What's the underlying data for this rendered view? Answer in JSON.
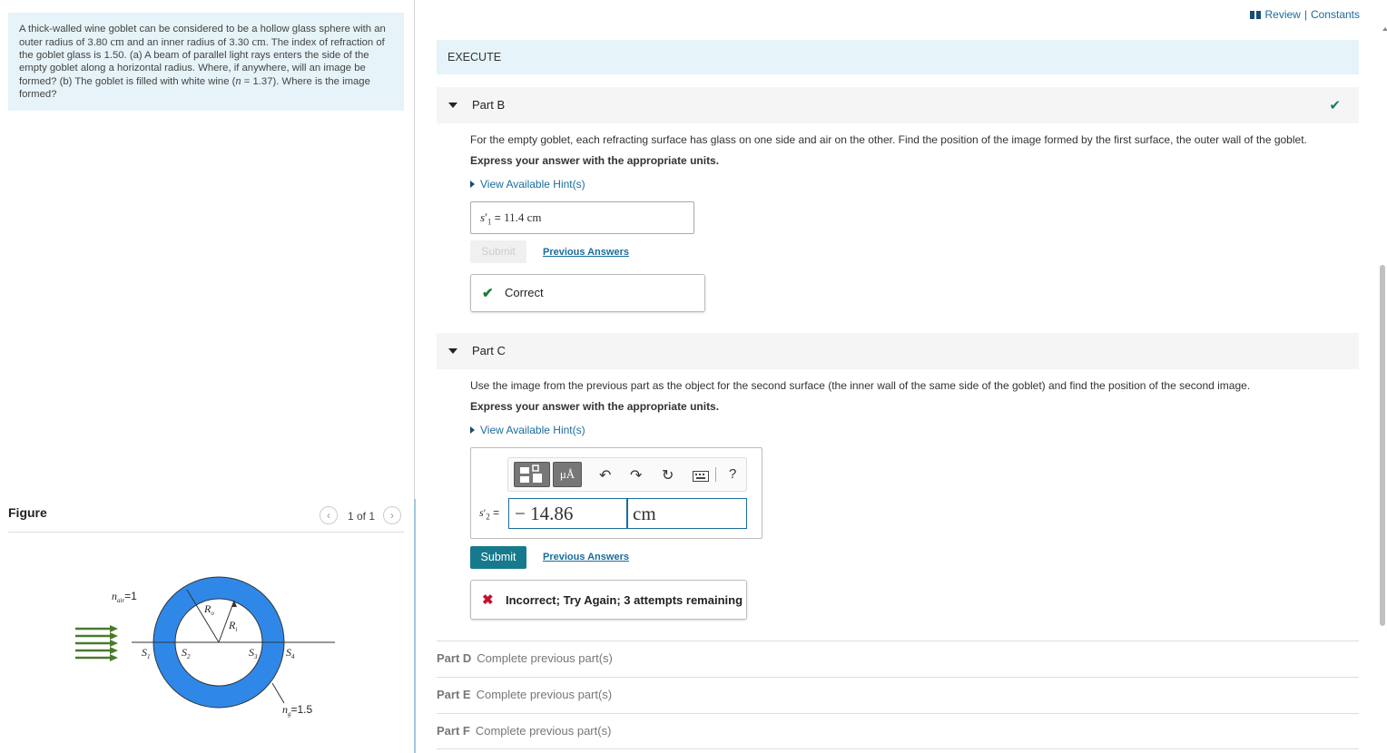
{
  "problem": {
    "parts": [
      "A thick-walled wine goblet can be considered to be a hollow glass sphere with an outer radius of 3.80 ",
      "cm",
      " and an inner radius of 3.30 ",
      "cm",
      ". The index of refraction of the goblet glass is 1.50. (a) A beam of parallel light rays enters the side of the empty goblet along a horizontal radius. Where, if anywhere, will an image be formed? (b) The goblet is filled with white wine (",
      "n",
      " = 1.37). Where is the image formed?"
    ]
  },
  "figure": {
    "label": "Figure",
    "counter": "1 of 1",
    "n_air": "n",
    "n_air_sub": "air",
    "n_air_val": "=1",
    "n_g": "n",
    "n_g_sub": "g",
    "n_g_val": "=1.5",
    "Ro": "R",
    "Ro_sub": "o",
    "Ri": "R",
    "Ri_sub": "i",
    "S1": "S",
    "S1_sub": "1",
    "S2": "S",
    "S2_sub": "2",
    "S3": "S",
    "S3_sub": "3",
    "S4": "S",
    "S4_sub": "4",
    "colors": {
      "ring": "#2f88e8",
      "arrows": "#4a7a2a"
    }
  },
  "header": {
    "review": "Review",
    "sep": " | ",
    "constants": "Constants",
    "execute": "EXECUTE"
  },
  "partB": {
    "title": "Part B",
    "instruction": "For the empty goblet, each refracting surface has glass on one side and air on the other. Find the position of the image formed by the first surface, the outer wall of the goblet.",
    "units_note": "Express your answer with the appropriate units.",
    "hint": "View Available Hint(s)",
    "answer_label": "s",
    "answer_prime": "′",
    "answer_sub": "1",
    "answer_eq": " = ",
    "answer_value": "11.4 cm",
    "submit": "Submit",
    "previous": "Previous Answers",
    "feedback": "Correct"
  },
  "partC": {
    "title": "Part C",
    "instruction": "Use the image from the previous part as the object for the second surface (the inner wall of the same side of the goblet) and find the position of the second image.",
    "units_note": "Express your answer with the appropriate units.",
    "hint": "View Available Hint(s)",
    "answer_label": "s",
    "answer_prime": "′",
    "answer_sub": "2",
    "answer_eq": " =",
    "value": "− 14.86",
    "unit": "cm",
    "toolbar": {
      "units_btn": "μÅ",
      "help": "?"
    },
    "submit": "Submit",
    "previous": "Previous Answers",
    "feedback": "Incorrect; Try Again; 3 attempts remaining"
  },
  "locked_parts": [
    {
      "label": "Part D",
      "text": "Complete previous part(s)"
    },
    {
      "label": "Part E",
      "text": "Complete previous part(s)"
    },
    {
      "label": "Part F",
      "text": "Complete previous part(s)"
    }
  ]
}
